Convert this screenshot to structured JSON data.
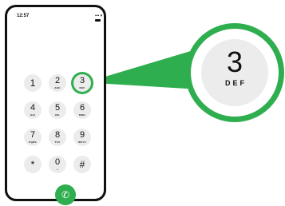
{
  "status_bar": {
    "time": "12:57",
    "signal": "•••",
    "wifi": "▾"
  },
  "keypad": {
    "keys": [
      {
        "digit": "1",
        "letters": ""
      },
      {
        "digit": "2",
        "letters": "ABC"
      },
      {
        "digit": "3",
        "letters": "DEF"
      },
      {
        "digit": "4",
        "letters": "GHI"
      },
      {
        "digit": "5",
        "letters": "JKL"
      },
      {
        "digit": "6",
        "letters": "MNO"
      },
      {
        "digit": "7",
        "letters": "PQRS"
      },
      {
        "digit": "8",
        "letters": "TUV"
      },
      {
        "digit": "9",
        "letters": "WXYZ"
      },
      {
        "digit": "*",
        "letters": ""
      },
      {
        "digit": "0",
        "letters": "+"
      },
      {
        "digit": "#",
        "letters": ""
      }
    ],
    "highlighted_digit": "3"
  },
  "call_button": {
    "icon": "phone-icon",
    "glyph": "✆"
  },
  "zoom": {
    "digit": "3",
    "letters": "DEF"
  },
  "colors": {
    "accent": "#2fae4f",
    "key_bg": "#ececec"
  }
}
